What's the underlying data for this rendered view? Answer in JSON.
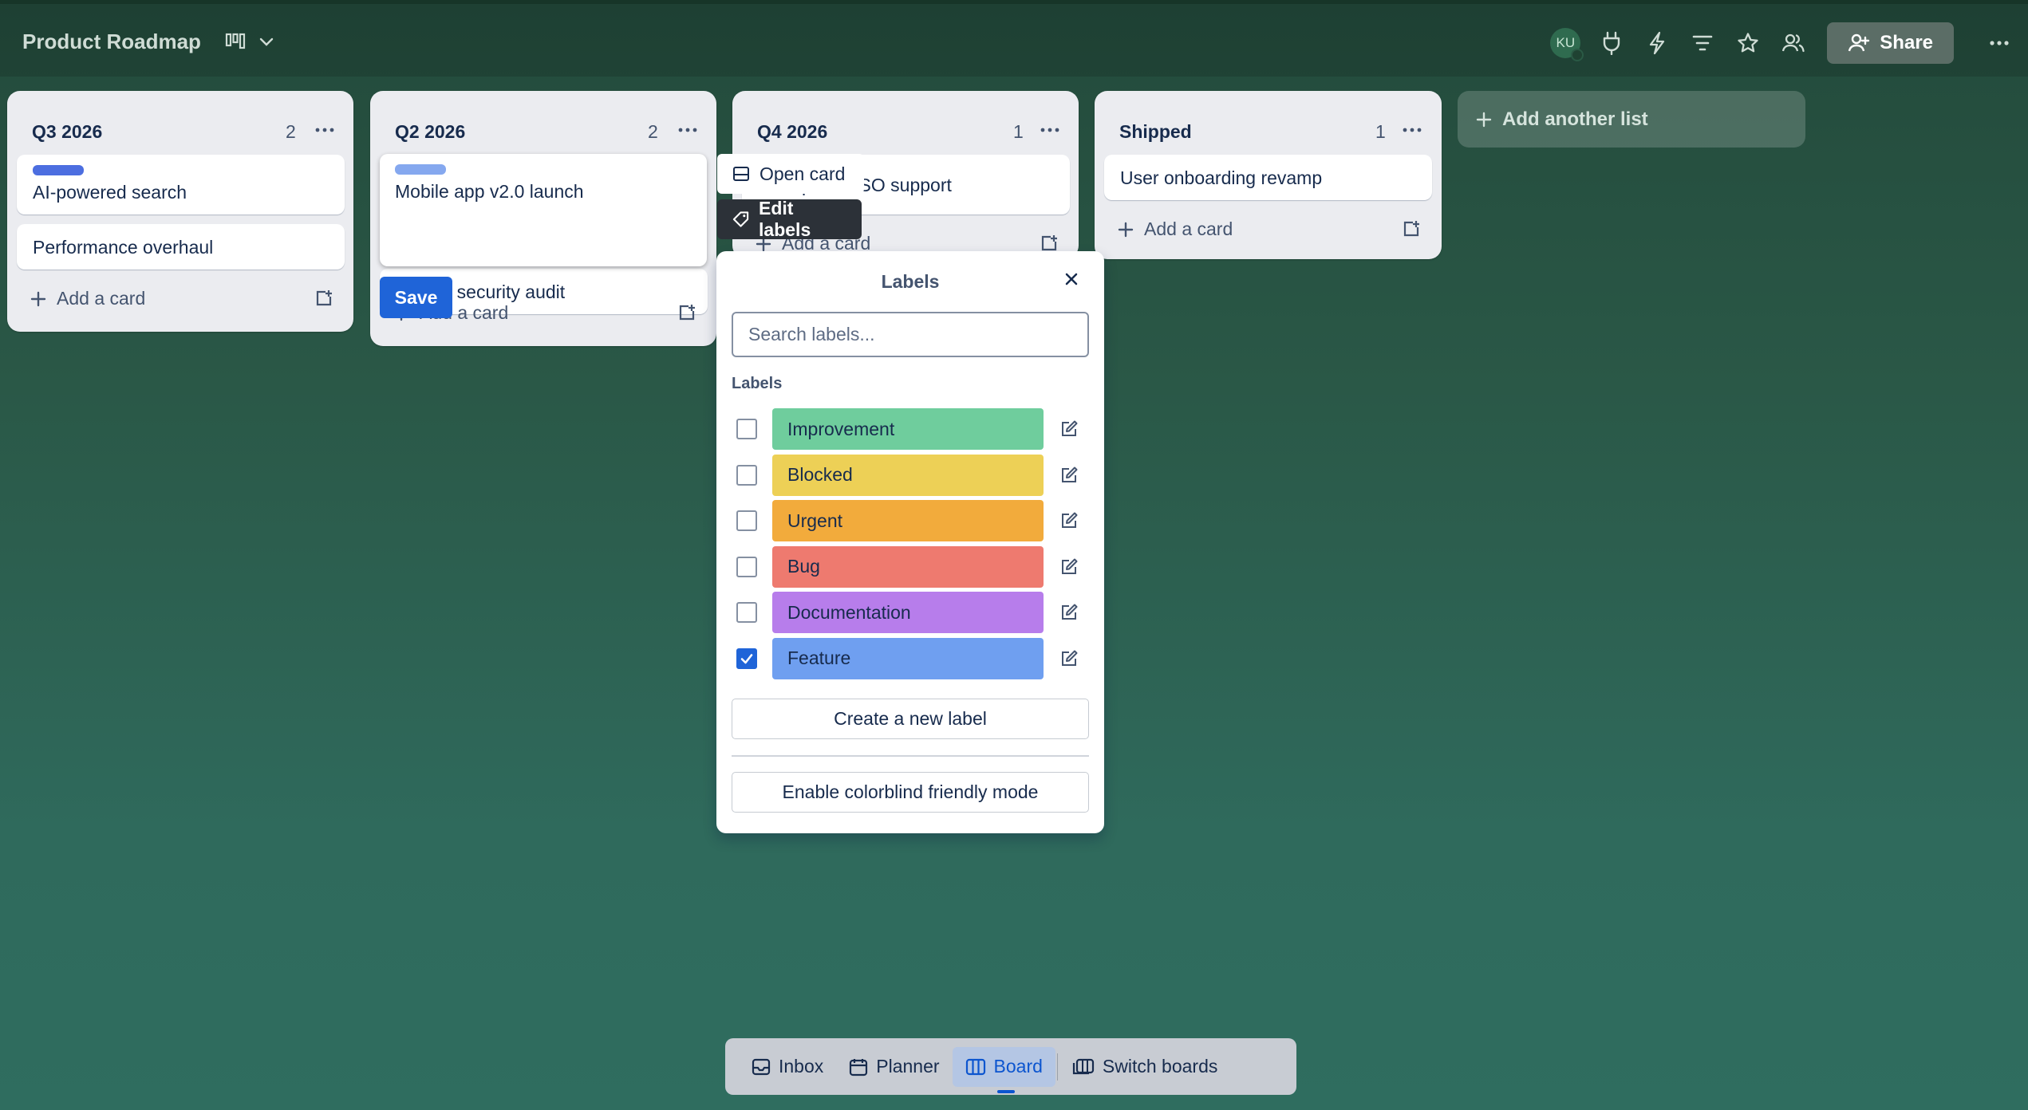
{
  "header": {
    "board_title": "Product Roadmap",
    "avatar_initials": "KU",
    "share_label": "Share"
  },
  "lists": [
    {
      "title": "Q3 2026",
      "count": "2",
      "cards": [
        "AI-powered search",
        "Performance overhaul"
      ],
      "add_card": "Add a card"
    },
    {
      "title": "Q2 2026",
      "count": "2",
      "cards": [
        "Mobile app v2.0 launch",
        "Critical security audit"
      ],
      "add_card": "Add a card"
    },
    {
      "title": "Q4 2026",
      "count": "1",
      "cards": [
        "Enterprise SSO support"
      ],
      "add_card": "Add a card"
    },
    {
      "title": "Shipped",
      "count": "1",
      "cards": [
        "User onboarding revamp"
      ],
      "add_card": "Add a card"
    }
  ],
  "add_list_label": "Add another list",
  "editor": {
    "text": "Mobile app v2.0 launch",
    "save_label": "Save"
  },
  "quick_actions": {
    "open_card": "Open card",
    "edit_labels": "Edit labels"
  },
  "labels_popover": {
    "title": "Labels",
    "search_placeholder": "Search labels...",
    "section_title": "Labels",
    "labels": [
      {
        "name": "Improvement",
        "color": "#6fcd9d",
        "checked": false
      },
      {
        "name": "Blocked",
        "color": "#edd056",
        "checked": false
      },
      {
        "name": "Urgent",
        "color": "#f2ab3c",
        "checked": false
      },
      {
        "name": "Bug",
        "color": "#ee7a6f",
        "checked": false
      },
      {
        "name": "Documentation",
        "color": "#b77deb",
        "checked": false
      },
      {
        "name": "Feature",
        "color": "#6f9ff0",
        "checked": true
      }
    ],
    "create_label": "Create a new label",
    "colorblind_label": "Enable colorblind friendly mode"
  },
  "dock": {
    "inbox": "Inbox",
    "planner": "Planner",
    "board": "Board",
    "switch_boards": "Switch boards"
  },
  "colors": {
    "accent": "#1f64d8",
    "feature_label": "#4c6ee0",
    "feature_label_light": "#85a8ef"
  }
}
